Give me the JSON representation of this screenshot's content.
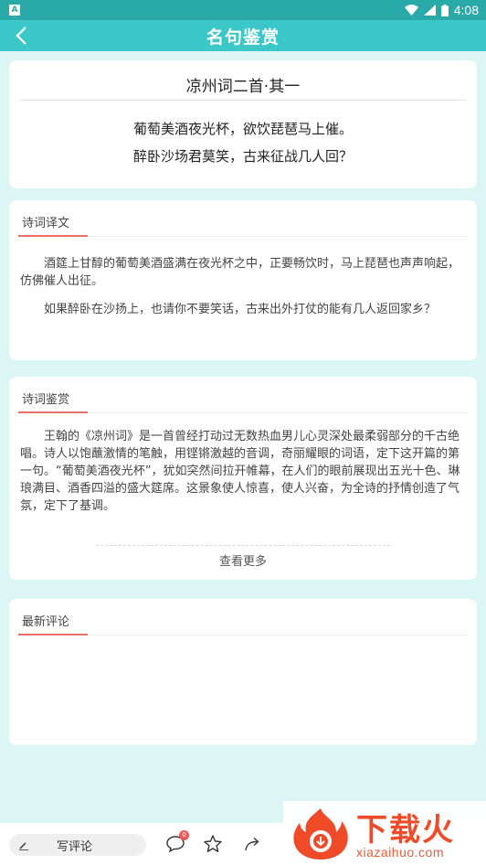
{
  "status_bar": {
    "app_badge": "A",
    "time": "4:08"
  },
  "header": {
    "title": "名句鉴赏"
  },
  "poem": {
    "title": "凉州词二首·其一",
    "lines": [
      "葡萄美酒夜光杯，欲饮琵琶马上催。",
      "醉卧沙场君莫笑，古来征战几人回？"
    ]
  },
  "translation": {
    "title": "诗词译文",
    "paragraphs": [
      "酒筵上甘醇的葡萄美酒盛满在夜光杯之中，正要畅饮时，马上琵琶也声声响起，仿佛催人出征。",
      "如果醉卧在沙扬上，也请你不要笑话，古来出外打仗的能有几人返回家乡？"
    ]
  },
  "appreciation": {
    "title": "诗词鉴赏",
    "paragraph": "王翰的《凉州词》是一首曾经打动过无数热血男儿心灵深处最柔弱部分的千古绝唱。诗人以饱蘸激情的笔触，用铿锵激越的音调，奇丽耀眼的词语，定下这开篇的第一句。“葡萄美酒夜光杯”，犹如突然间拉开帷幕，在人们的眼前展现出五光十色、琳琅满目、酒香四溢的盛大筵席。这景象使人惊喜，使人兴奋，为全诗的抒情创造了气氛，定下了基调。",
    "more_label": "查看更多"
  },
  "comments": {
    "title": "最新评论"
  },
  "bottom_bar": {
    "write_label": "写评论",
    "comment_badge": "0",
    "icons": [
      "pen-icon",
      "comment-icon",
      "star-icon",
      "share-icon"
    ]
  },
  "watermark": {
    "brand": "下载火",
    "url": "xiazaihuo.com"
  },
  "colors": {
    "status_bar": "#2aa9a9",
    "header": "#3cc8c8",
    "background": "#dcf6f6",
    "accent_underline": "#e9706a",
    "watermark": "#f04b28"
  }
}
